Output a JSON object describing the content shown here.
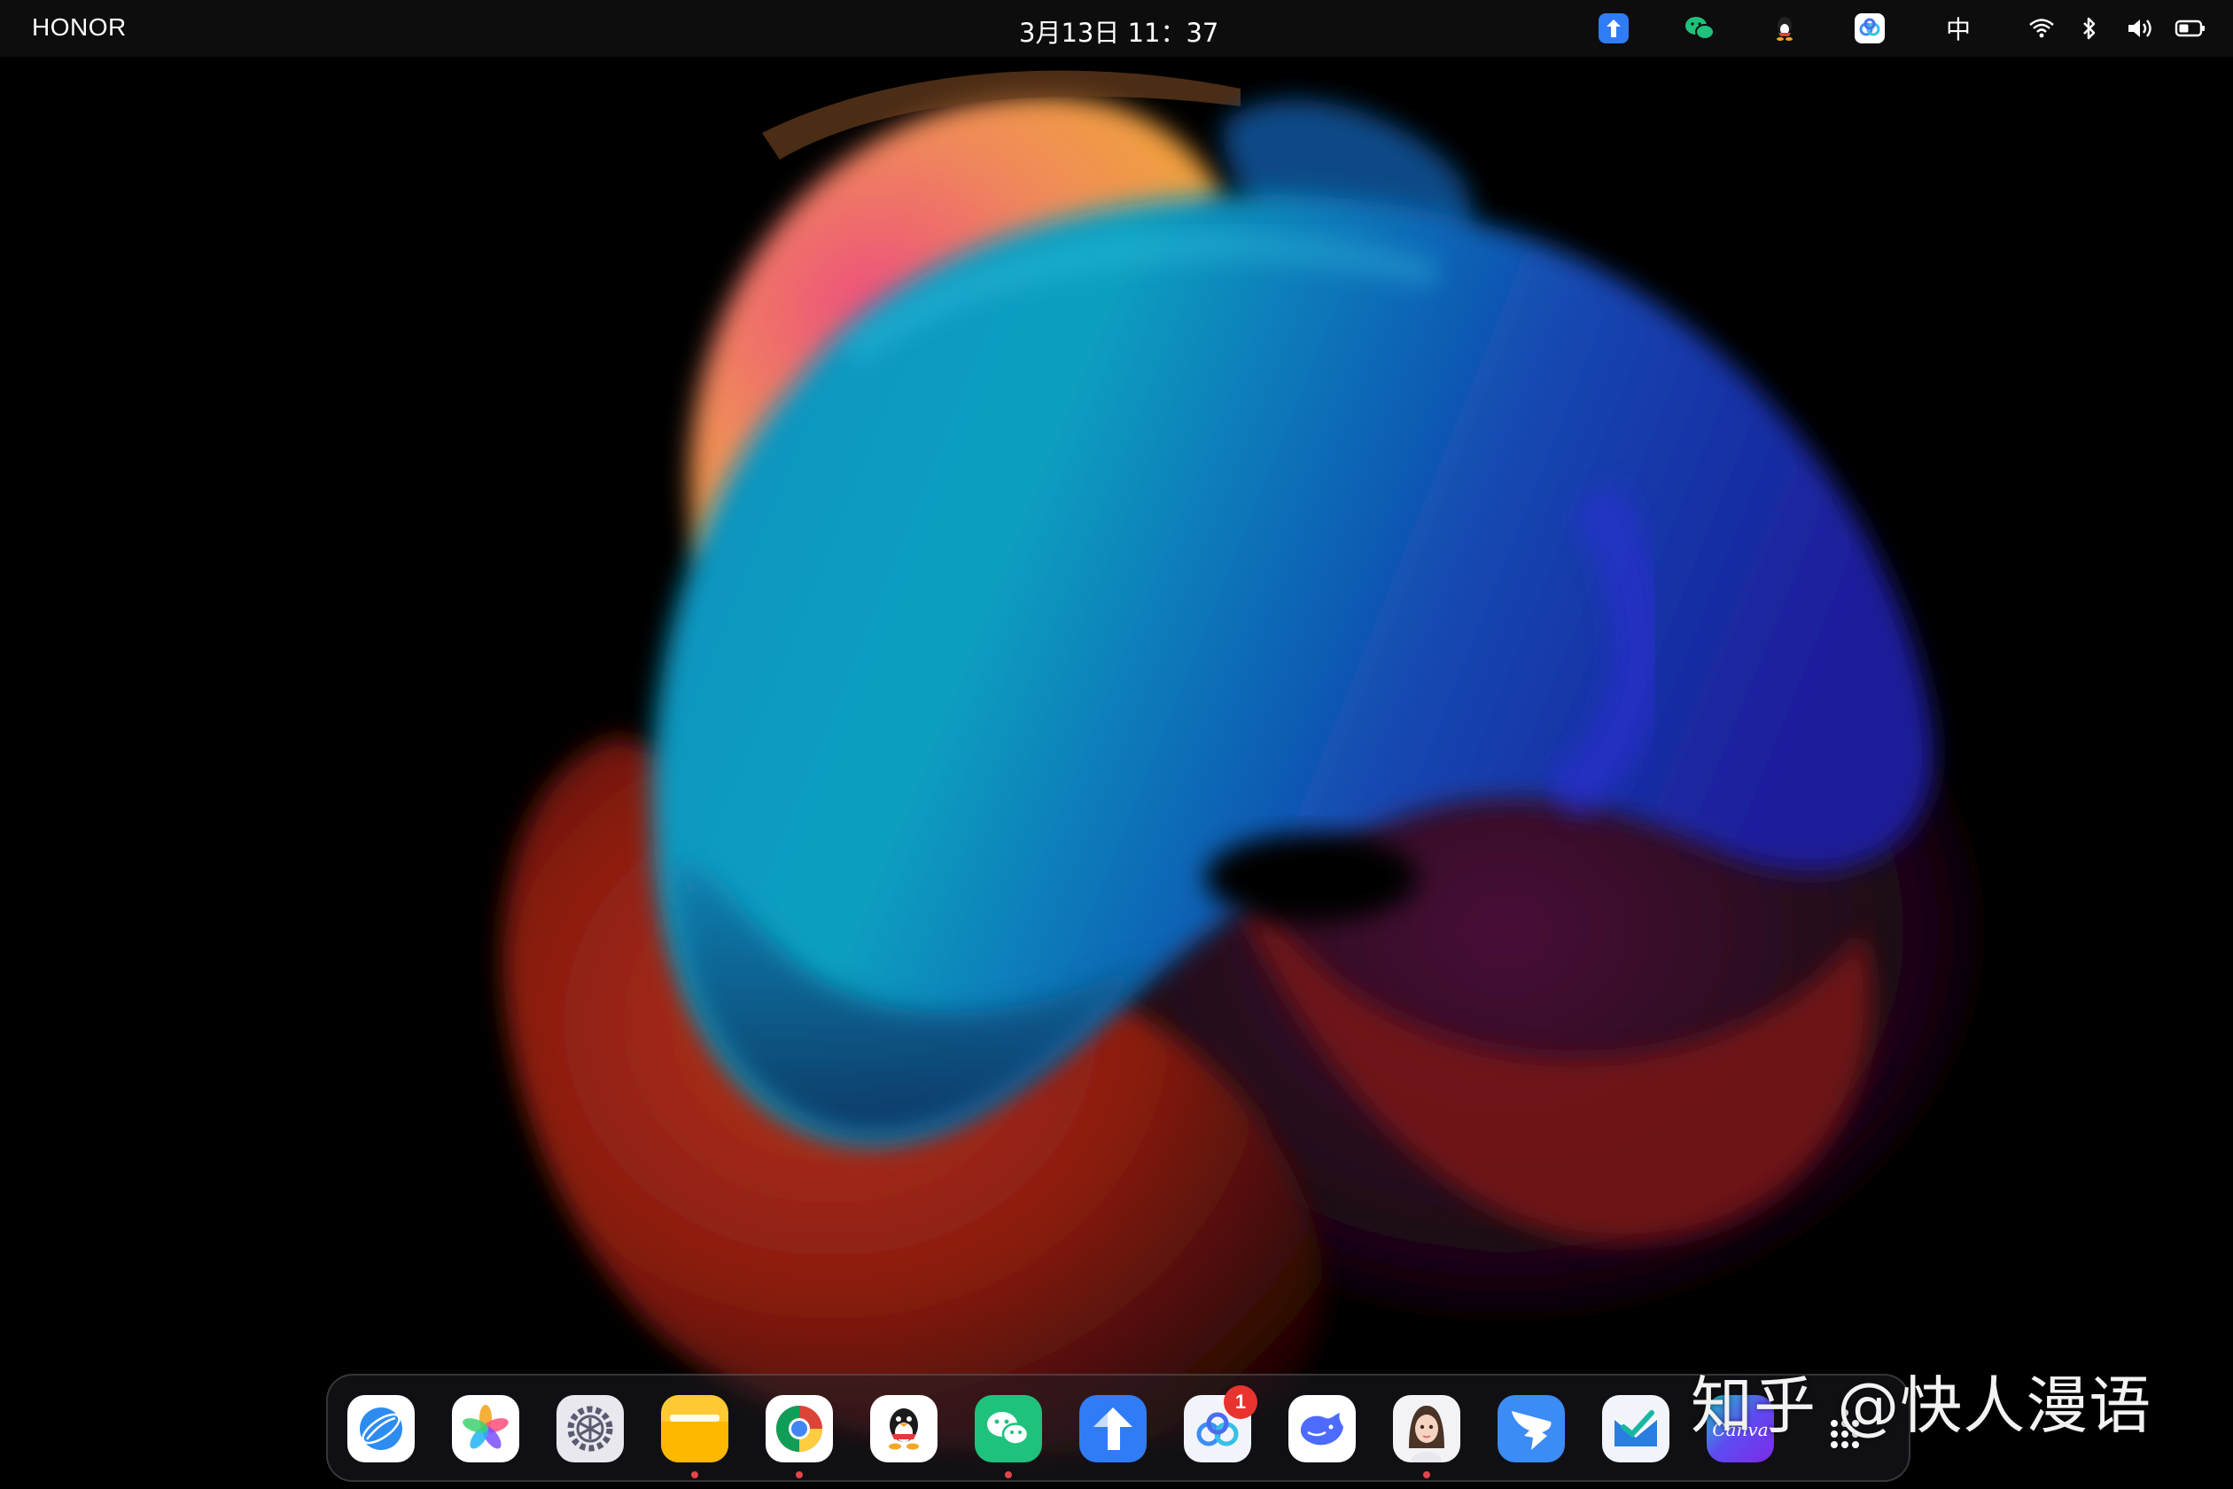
{
  "status_bar": {
    "brand": "HONOR",
    "datetime": "3月13日  11：37",
    "input_method": "中",
    "tray_icons": [
      "transfer-app-icon",
      "wechat-icon",
      "qq-icon",
      "baidu-netdisk-icon",
      "wifi-icon",
      "bluetooth-icon",
      "volume-icon",
      "battery-icon"
    ]
  },
  "dock": {
    "apps": [
      {
        "name": "browser",
        "icon": "browser-icon",
        "running": false
      },
      {
        "name": "gallery",
        "icon": "gallery-icon",
        "running": false
      },
      {
        "name": "settings",
        "icon": "settings-icon",
        "running": false
      },
      {
        "name": "files",
        "icon": "folder-icon",
        "running": true
      },
      {
        "name": "chrome",
        "icon": "chrome-icon",
        "running": true
      },
      {
        "name": "qq",
        "icon": "qq-penguin-icon",
        "running": false
      },
      {
        "name": "wechat",
        "icon": "wechat-icon",
        "running": true
      },
      {
        "name": "transfer",
        "icon": "transfer-arrow-icon",
        "running": false
      },
      {
        "name": "baidu-netdisk",
        "icon": "cloud-icon",
        "running": false,
        "badge": "1"
      },
      {
        "name": "deepseek",
        "icon": "whale-icon",
        "running": false
      },
      {
        "name": "avatar-app",
        "icon": "avatar-icon",
        "running": true
      },
      {
        "name": "dingtalk",
        "icon": "dingtalk-icon",
        "running": false
      },
      {
        "name": "mail",
        "icon": "envelope-check-icon",
        "running": false
      },
      {
        "name": "canva",
        "icon": "canva-icon",
        "label": "Canva",
        "running": false
      }
    ],
    "app_drawer_icon": "grid-dots-icon",
    "notification_badge": "1"
  },
  "watermark": "知乎 @快人漫语",
  "colors": {
    "background": "#000000",
    "statusbar": "#0d0d0d",
    "badge": "#e8332f",
    "running_dot": "#e0454a",
    "wechat_green": "#1ec27d",
    "honor_blue": "#2f7cf6"
  }
}
